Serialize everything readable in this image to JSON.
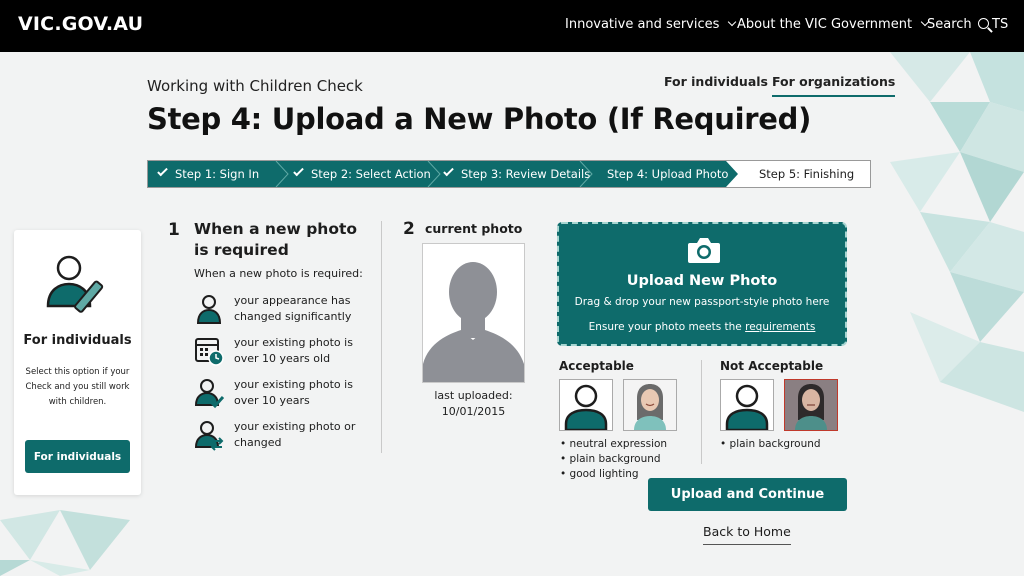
{
  "header": {
    "logo": "VIC.GOV.AU",
    "nav": [
      {
        "label": "Innovative and services"
      },
      {
        "label": "About the VIC Government"
      }
    ],
    "search_label": "Search",
    "user_initials": "TS"
  },
  "page": {
    "subtitle": "Working with Children Check",
    "title": "Step 4: Upload a New Photo (If Required)",
    "tabs": [
      {
        "label": "For individuals",
        "active": false
      },
      {
        "label": "For organizations",
        "active": true
      }
    ]
  },
  "stepper": {
    "steps": [
      {
        "label": "Step 1: Sign In",
        "status": "complete"
      },
      {
        "label": "Step 2: Select Action",
        "status": "complete"
      },
      {
        "label": "Step 3: Review Details",
        "status": "complete"
      },
      {
        "label": "Step 4: Upload Photo",
        "status": "current"
      },
      {
        "label": "Step 5: Finishing",
        "status": "upcoming"
      }
    ]
  },
  "side_card": {
    "title": "For individuals",
    "description": "Select this option if your Check and you still work with children.",
    "button_label": "For individuals"
  },
  "section1": {
    "number": "1",
    "title": "When a new photo is required",
    "subtitle": "When a new photo is required:",
    "items": [
      {
        "icon": "person-icon",
        "text": "your appearance has changed significantly"
      },
      {
        "icon": "calendar-clock-icon",
        "text": "your existing photo is over 10 years old"
      },
      {
        "icon": "person-check-icon",
        "text": "your existing photo is over 10 years"
      },
      {
        "icon": "person-swap-icon",
        "text": "your existing photo or changed"
      }
    ]
  },
  "section2": {
    "number": "2",
    "title": "current photo",
    "last_uploaded_label": "last uploaded:",
    "last_uploaded_date": "10/01/2015"
  },
  "upload": {
    "title": "Upload New Photo",
    "description": "Drag & drop your new passport-style photo here",
    "ensure_text": "Ensure your photo meets the",
    "requirements_link": "requirements"
  },
  "examples": {
    "acceptable_title": "Acceptable",
    "acceptable_bullets": [
      "• neutral expression",
      "• plain background",
      "• good lighting"
    ],
    "not_acceptable_title": "Not Acceptable",
    "not_acceptable_bullets": [
      "• plain background"
    ]
  },
  "actions": {
    "primary_label": "Upload and Continue",
    "back_label": "Back to Home"
  },
  "colors": {
    "teal": "#0e6b6b",
    "header_bg": "#000000",
    "page_bg": "#f2f3f3"
  }
}
